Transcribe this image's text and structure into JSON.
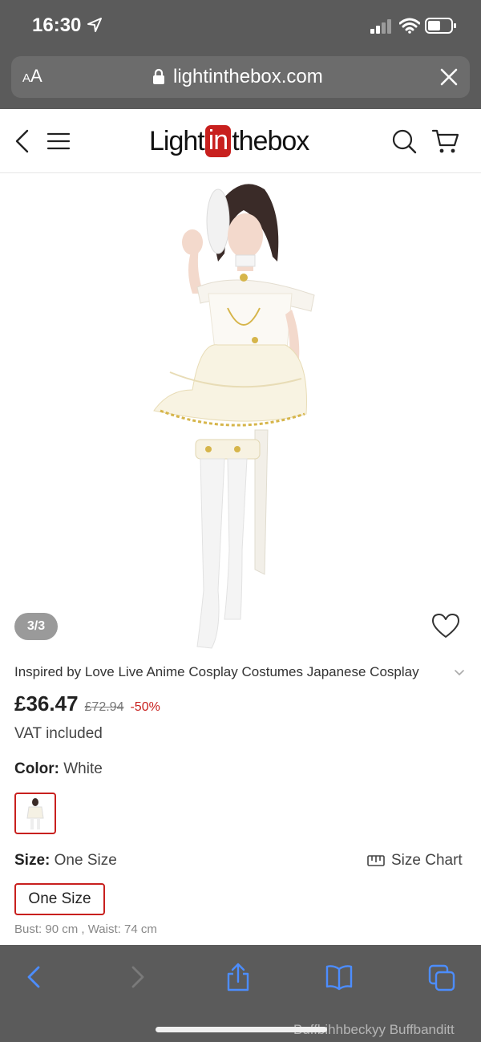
{
  "status_bar": {
    "time": "16:30"
  },
  "url_bar": {
    "aa_small": "A",
    "aa_large": "A",
    "url": "lightinthebox.com"
  },
  "header": {
    "logo_left": "Light",
    "logo_in": "in",
    "logo_right": "thebox"
  },
  "gallery": {
    "counter": "3/3"
  },
  "product": {
    "title": "Inspired by Love Live Anime Cosplay Costumes Japanese Cosplay",
    "price": "£36.47",
    "original_price": "£72.94",
    "discount": "-50%",
    "vat": "VAT included",
    "color_label": "Color:",
    "color_value": "White",
    "size_label": "Size:",
    "size_value": "One Size",
    "size_chart": "Size Chart",
    "size_option": "One Size",
    "measurements": "Bust: 90 cm , Waist: 74 cm"
  },
  "watermark": "Buffbihhbeckyy Buffbanditt",
  "colors": {
    "accent": "#c8201e",
    "chrome": "#5b5b5b",
    "toolbar_icon": "#4c8dff"
  }
}
